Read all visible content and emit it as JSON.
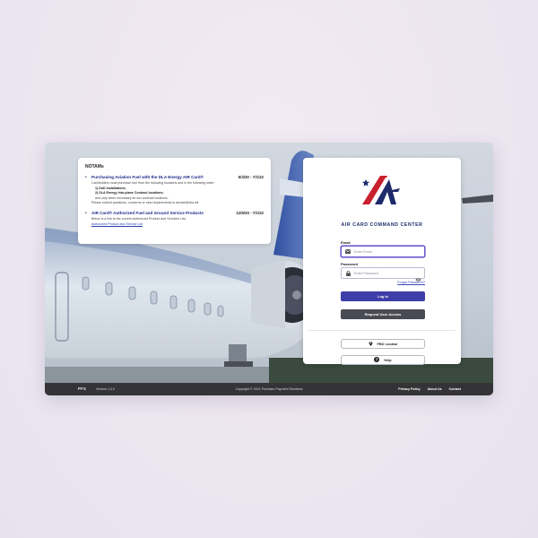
{
  "notams": {
    "title": "NOTAMs",
    "items": [
      {
        "title": "Purchasing Aviation Fuel with the DLA Energy AIR Card®",
        "date": "6/3/20 - 7/1/22",
        "lines": [
          "Cardholders must purchase fuel from the following locations and in the following order:"
        ],
        "list": [
          "1) DoD Installations;",
          "2) DLA Energy Into-plane Contract locations;",
          "and only when necessary at non-contract locations."
        ],
        "note": "Please submit questions, concerns or new requirements to aircard@dla.mil"
      },
      {
        "title": "AIR Card® Authorized Fuel and Ground Service Products",
        "date": "12/9/20 - 7/1/22",
        "lines": [
          "Below is a link to the current Authorized Product and Services List."
        ],
        "link": "Authorized Product and Service List"
      }
    ]
  },
  "login": {
    "brand": "AIR CARD COMMAND CENTER",
    "email_label": "Email",
    "email_placeholder": "Enter Email",
    "password_label": "Password",
    "password_placeholder": "Enter Password",
    "forgot": "Forgot Password?",
    "login_button": "Log In",
    "request_button": "Request User Access",
    "fbo_button": "FBO Locator",
    "help_button": "Help"
  },
  "footer": {
    "logo": "PFS",
    "version": "Version 1.0.0",
    "copyright": "Copyright © 2021 Precision Payment Solutions",
    "links": [
      "Privacy Policy",
      "About Us",
      "Contact"
    ]
  },
  "colors": {
    "brand_navy": "#1d2a6b",
    "brand_red": "#c8202e",
    "login_button": "#3e3ea8",
    "request_button": "#4a4a55",
    "footer": "#343436"
  }
}
